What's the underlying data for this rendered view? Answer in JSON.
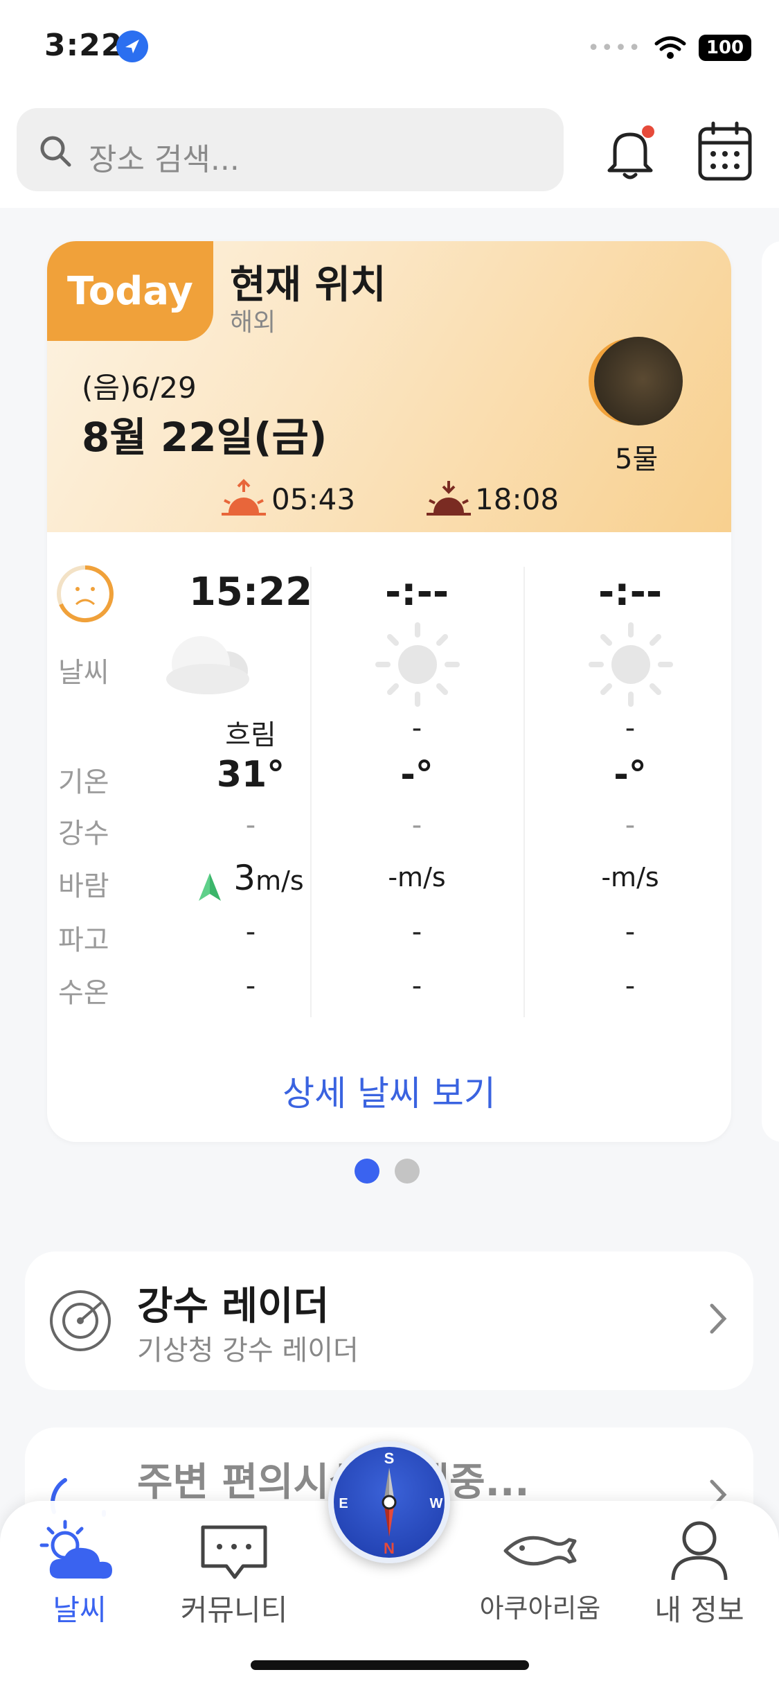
{
  "status_bar": {
    "time": "3:22",
    "battery": "100"
  },
  "header": {
    "search_placeholder": "장소 검색..."
  },
  "weather": {
    "badge": "Today",
    "location_title": "현재 위치",
    "location_sub": "해외",
    "lunar_date": "(음)6/29",
    "date": "8월 22일(금)",
    "moon_phase": "5물",
    "sunrise": "05:43",
    "sunset": "18:08",
    "row_labels": {
      "weather": "날씨",
      "temp": "기온",
      "precip": "강수",
      "wind": "바람",
      "wave": "파고",
      "water_temp": "수온"
    },
    "columns": [
      {
        "time": "15:22",
        "condition": "흐림",
        "temp": "31°",
        "precip": "-",
        "wind_value": "3",
        "wind_unit": "m/s",
        "wave": "-",
        "water_temp": "-"
      },
      {
        "time": "-:--",
        "condition": "-",
        "temp": "-°",
        "precip": "-",
        "wind_value": "-",
        "wind_unit": "m/s",
        "wave": "-",
        "water_temp": "-"
      },
      {
        "time": "-:--",
        "condition": "-",
        "temp": "-°",
        "precip": "-",
        "wind_value": "-",
        "wind_unit": "m/s",
        "wave": "-",
        "water_temp": "-"
      }
    ],
    "detail_link": "상세 날씨 보기"
  },
  "radar": {
    "title": "강수 레이더",
    "sub": "기상청 강수 레이더"
  },
  "facility": {
    "title": "주변 편의시설 검색중..."
  },
  "tabs": [
    {
      "label": "날씨",
      "icon": "weather-icon",
      "active": true
    },
    {
      "label": "커뮤니티",
      "icon": "chat-icon",
      "active": false
    },
    {
      "label": "아쿠아리움",
      "icon": "fish-icon",
      "active": false
    },
    {
      "label": "내 정보",
      "icon": "profile-icon",
      "active": false
    }
  ],
  "compass": {
    "n": "N",
    "s": "S",
    "e": "E",
    "w": "W"
  },
  "colors": {
    "accent_blue": "#3a63f0",
    "today_orange": "#f0a13a",
    "link_blue": "#3a63e0"
  }
}
